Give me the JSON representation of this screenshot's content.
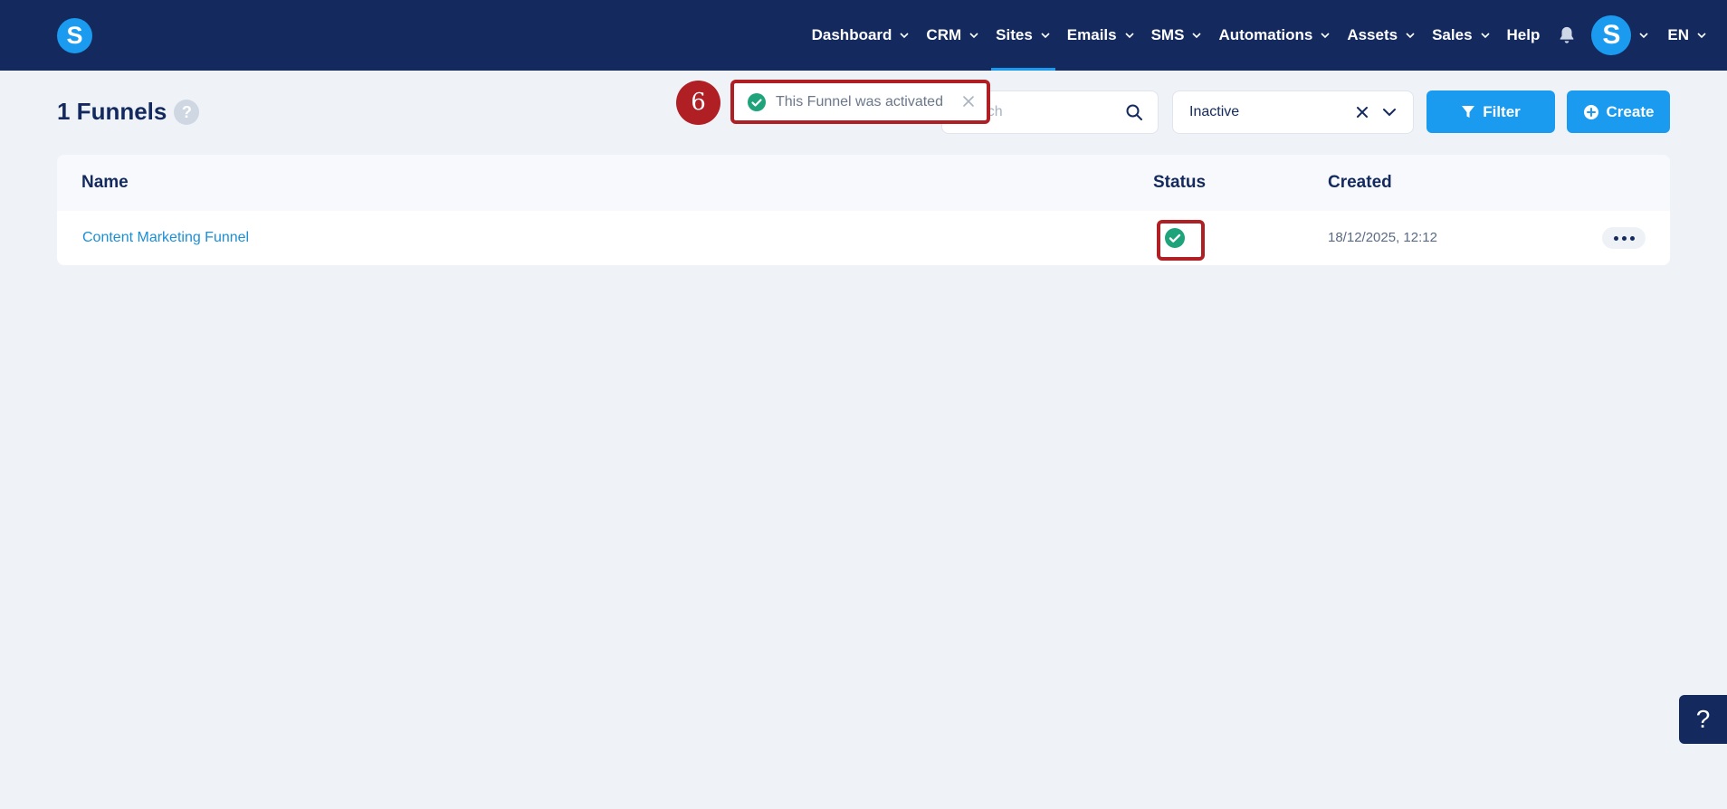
{
  "brand": {
    "logo_letter": "S"
  },
  "nav": {
    "items": [
      {
        "label": "Dashboard",
        "has_dropdown": true
      },
      {
        "label": "CRM",
        "has_dropdown": true
      },
      {
        "label": "Sites",
        "has_dropdown": true,
        "active": true
      },
      {
        "label": "Emails",
        "has_dropdown": true
      },
      {
        "label": "SMS",
        "has_dropdown": true
      },
      {
        "label": "Automations",
        "has_dropdown": true
      },
      {
        "label": "Assets",
        "has_dropdown": true
      },
      {
        "label": "Sales",
        "has_dropdown": true
      },
      {
        "label": "Help",
        "has_dropdown": false
      }
    ],
    "avatar_letter": "S",
    "language": "EN"
  },
  "page": {
    "title": "1 Funnels",
    "help_icon": "?"
  },
  "search": {
    "placeholder": "Search",
    "value": ""
  },
  "status_filter": {
    "selected": "Inactive"
  },
  "buttons": {
    "filter": "Filter",
    "create": "Create"
  },
  "table": {
    "headers": {
      "name": "Name",
      "status": "Status",
      "created": "Created"
    },
    "rows": [
      {
        "name": "Content Marketing Funnel",
        "status": "active",
        "created": "18/12/2025, 12:12"
      }
    ]
  },
  "toast": {
    "message": "This Funnel was activated"
  },
  "annotation": {
    "step": "6"
  },
  "floating_help": {
    "label": "?"
  },
  "colors": {
    "navy": "#142a5e",
    "accent": "#1a9bf0",
    "success": "#1fa37b",
    "annotation": "#b01f24"
  }
}
